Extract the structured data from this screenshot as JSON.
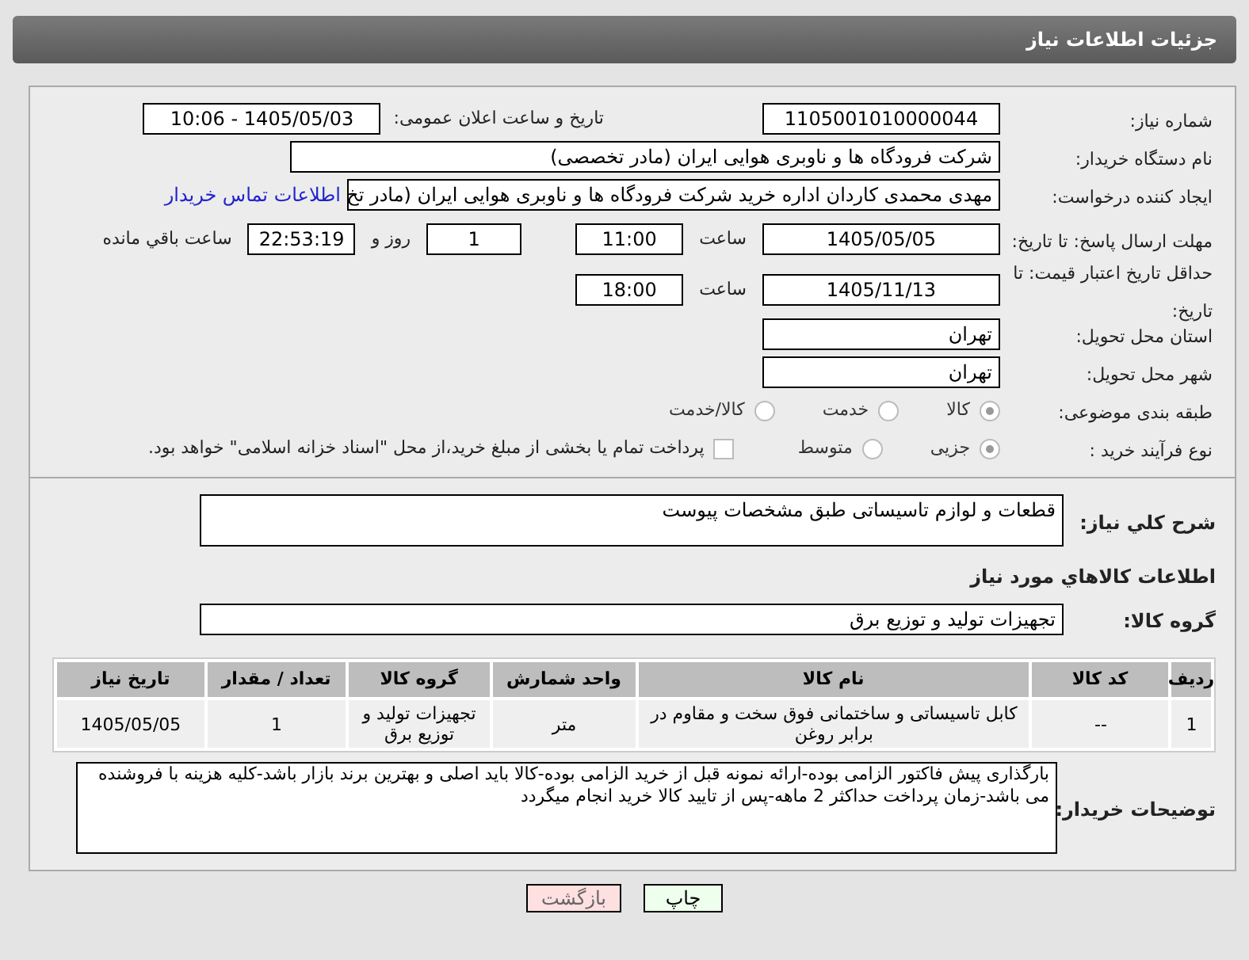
{
  "header": {
    "title": "جزئیات اطلاعات نیاز"
  },
  "fields": {
    "need_number_label": "شماره نیاز:",
    "need_number": "1105001010000044",
    "announce_label": "تاریخ و ساعت اعلان عمومی:",
    "announce": "1405/05/03 - 10:06",
    "buyer_label": "نام دستگاه خریدار:",
    "buyer": "شرکت فرودگاه ها و ناوبری هوایی ایران (مادر تخصصی)",
    "requester_label": "ایجاد کننده درخواست:",
    "requester": "مهدی محمدی کاردان اداره خرید شرکت فرودگاه ها و ناوبری هوایی ایران (مادر تخ",
    "contact_link": "اطلاعات تماس خریدار",
    "deadline_label": "مهلت ارسال پاسخ: تا تاریخ:",
    "deadline_date": "1405/05/05",
    "deadline_time_label": "ساعت",
    "deadline_time": "11:00",
    "days": "1",
    "days_label": "روز و",
    "remaining": "22:53:19",
    "remaining_label": "ساعت باقي مانده",
    "validity_label": "حداقل تاریخ اعتبار قیمت: تا تاریخ:",
    "validity_date": "1405/11/13",
    "validity_time_label": "ساعت",
    "validity_time": "18:00",
    "province_label": "استان محل تحویل:",
    "province": "تهران",
    "city_label": "شهر محل تحویل:",
    "city": "تهران"
  },
  "category": {
    "label": "طبقه بندی موضوعی:",
    "options": [
      {
        "label": "کالا",
        "selected": true
      },
      {
        "label": "خدمت",
        "selected": false
      },
      {
        "label": "کالا/خدمت",
        "selected": false
      }
    ]
  },
  "process": {
    "label": "نوع فرآیند خرید :",
    "options": [
      {
        "label": "جزیی",
        "selected": true
      },
      {
        "label": "متوسط",
        "selected": false
      }
    ],
    "payment_checked": false,
    "payment_text": "پرداخت تمام یا بخشی از مبلغ خرید،از محل \"اسناد خزانه اسلامی\" خواهد بود."
  },
  "description": {
    "label": "شرح کلي نياز:",
    "value": "قطعات و لوازم تاسیساتی طبق مشخصات پیوست"
  },
  "goods_title": "اطلاعات کالاهاي مورد نياز",
  "goods_group": {
    "label": "گروه کالا:",
    "value": "تجهیزات تولید و توزیع برق"
  },
  "table": {
    "columns": [
      "ردیف",
      "کد کالا",
      "نام کالا",
      "واحد شمارش",
      "گروه کالا",
      "تعداد / مقدار",
      "تاریخ نیاز"
    ],
    "rows": [
      [
        "1",
        "--",
        "کابل تاسیساتی و ساختمانی فوق سخت و مقاوم در برابر روغن",
        "متر",
        "تجهیزات تولید و توزیع برق",
        "1",
        "1405/05/05"
      ]
    ]
  },
  "buyer_notes": {
    "label": "توضیحات خریدار:",
    "value": "بارگذاری پیش فاکتور الزامی بوده-ارائه نمونه قبل از خرید الزامی بوده-کالا باید اصلی و بهترین برند بازار باشد-کلیه هزینه با فروشنده می باشد-زمان پرداخت حداکثر 2 ماهه-پس از تایید کالا خرید انجام میگردد"
  },
  "buttons": [
    {
      "label": "چاپ",
      "kind": "print"
    },
    {
      "label": "بازگشت",
      "kind": "back"
    }
  ]
}
